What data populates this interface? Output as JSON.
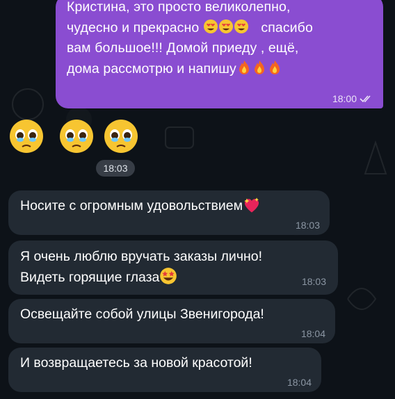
{
  "outgoing": {
    "lines": [
      "Кристина, это просто великолепно,",
      "чудесно и прекрасно",
      "спасибо",
      "вам большое!!! Домой приеду , ещё,",
      "дома рассмотрю и напишу"
    ],
    "time": "18:00",
    "status_icon": "double-check-icon"
  },
  "sticker_time": "18:03",
  "incoming": [
    {
      "line1": "Носите с огромным удовольствием",
      "line2": "",
      "time": "18:03",
      "emoji": "sparkling-heart-icon"
    },
    {
      "line1": "Я очень люблю вручать заказы лично!",
      "line2": "Видеть горящие глаза",
      "time": "18:03",
      "emoji": "star-struck-icon"
    },
    {
      "line1": "Освещайте собой улицы Звенигорода!",
      "line2": "",
      "time": "18:04"
    },
    {
      "line1": "И возвращаетесь за новой красотой!",
      "line2": "",
      "time": "18:04"
    }
  ],
  "colors": {
    "outgoing_bubble": "#8a4dd1",
    "incoming_bubble": "#222a33",
    "background": "#0d1218"
  }
}
